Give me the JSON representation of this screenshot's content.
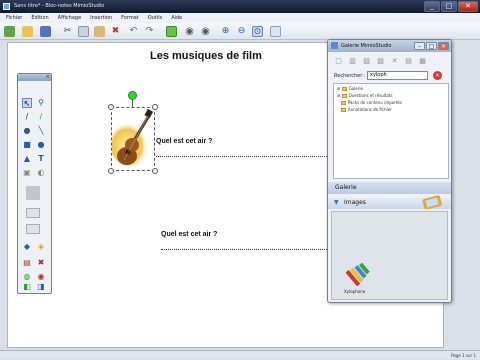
{
  "window": {
    "title": "Sans titre* - Bloc-notes MimioStudio",
    "buttons": [
      "_",
      "□",
      "✕"
    ]
  },
  "menu": {
    "items": [
      "Fichier",
      "Édition",
      "Affichage",
      "Insertion",
      "Format",
      "Outils",
      "Aide"
    ]
  },
  "toolbar": {
    "icons": [
      "new-page-icon",
      "open-icon",
      "save-icon",
      "print-icon",
      "cut-icon",
      "copy-icon",
      "paste-icon",
      "delete-icon",
      "undo-icon",
      "redo-icon",
      "insert-page-icon",
      "previous-page-icon",
      "next-page-icon",
      "zoom-in-icon",
      "zoom-out-icon",
      "zoom-fit-icon",
      "screen-icon"
    ]
  },
  "page": {
    "title": "Les musiques de film",
    "question1": "Quel est cet air ?",
    "question2": "Quel est cet air ?"
  },
  "gallery": {
    "title": "Galerie MimioStudio",
    "search_label": "Rechercher :",
    "search_value": "xyloph",
    "tree": [
      "Galerie",
      "Questions et résultats",
      "Packs de contenu importés",
      "Annotations de fichier"
    ],
    "section_label": "Galerie",
    "category_label": "Images",
    "item_label": "Xylophone"
  },
  "status": {
    "page_info": "Page 1 sur 1"
  },
  "colors": {
    "accent": "#3ccf3c",
    "title_bar": "#1b2840"
  }
}
